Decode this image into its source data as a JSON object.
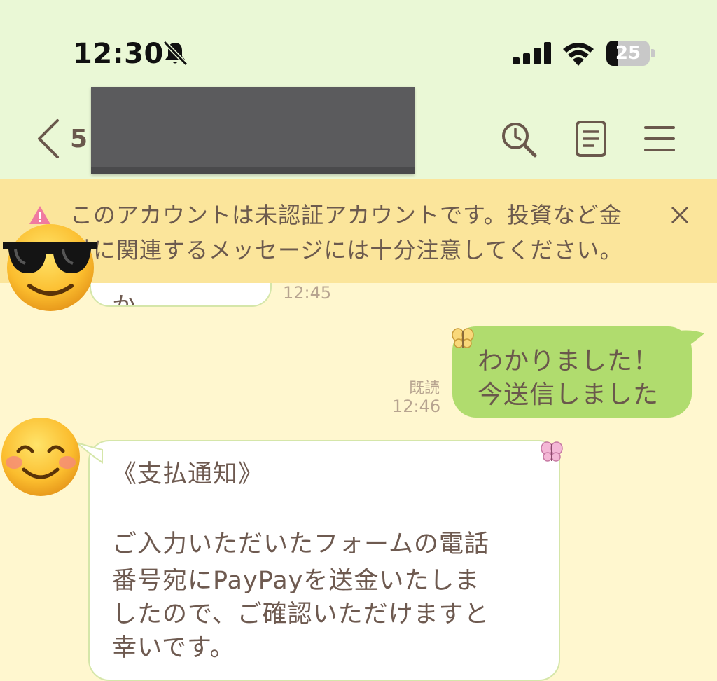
{
  "status_bar": {
    "time": "12:30",
    "battery_level": "25",
    "battery_fraction": 0.25,
    "icons": [
      "bell-slash-icon",
      "signal-bars-icon",
      "wifi-icon",
      "battery-icon"
    ]
  },
  "header": {
    "unread_count": "5",
    "icons": [
      "back-chevron-icon",
      "search-history-icon",
      "notes-icon",
      "menu-icon"
    ],
    "title_redacted": true
  },
  "banner": {
    "line1": "このアカウントは未認証アカウントです。投資など金",
    "line2": "融に関連するメッセージには十分注意してください。",
    "close_icon": "close-icon",
    "warning_icon": "warning-icon"
  },
  "messages": {
    "incoming_partial": {
      "text": "本日でしょうか",
      "time": "12:45"
    },
    "outgoing": {
      "line1": "わかりました！",
      "line2": "今送信しました",
      "read_label": "既読",
      "time": "12:46"
    },
    "incoming_long": {
      "title": "《支払通知》",
      "line1": "ご入力いただいたフォームの電話",
      "line2": "番号宛にPayPayを送金いたしま",
      "line3": "したので、ご確認いただけますと",
      "line4": "幸いです。"
    }
  },
  "colors": {
    "header_bg": "#eaf8d6",
    "chat_bg": "#fff7cf",
    "banner_bg": "#fbe59b",
    "outgoing_bubble": "#b0dc6e",
    "incoming_border": "#d5e6a9",
    "text_brown": "#6e5a50",
    "time_text": "#b7a490"
  }
}
